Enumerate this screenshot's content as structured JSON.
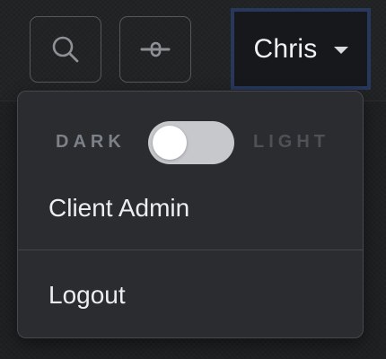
{
  "header": {
    "search_icon": "search-icon",
    "toggle_icon": "toggle-off-icon",
    "user": {
      "name": "Chris",
      "caret_icon": "caret-down-icon"
    }
  },
  "dropdown": {
    "theme": {
      "dark_label": "DARK",
      "light_label": "LIGHT",
      "current": "dark"
    },
    "items": [
      {
        "label": "Client Admin"
      },
      {
        "label": "Logout"
      }
    ]
  },
  "colors": {
    "background": "#1f2022",
    "menu_background": "#2a2c30",
    "focus_border": "#28375c",
    "switch_track": "#c6c8cc"
  }
}
